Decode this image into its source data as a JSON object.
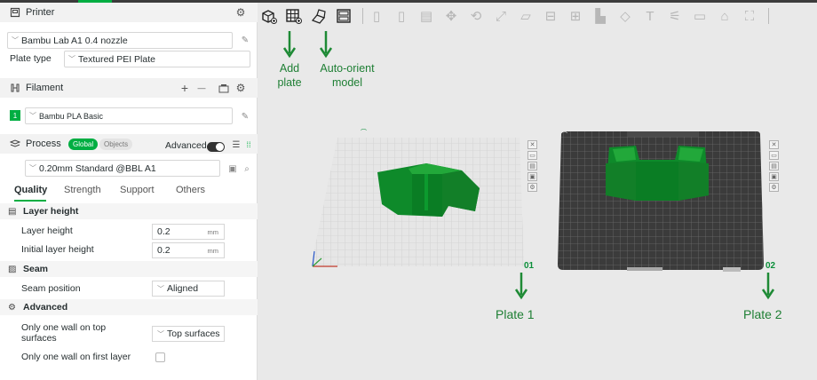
{
  "printer": {
    "section_title": "Printer",
    "model": "Bambu Lab A1 0.4 nozzle",
    "plate_type_label": "Plate type",
    "plate_type": "Textured PEI Plate"
  },
  "filament": {
    "section_title": "Filament",
    "add_label": "+",
    "remove_label": "—",
    "slot_number": "1",
    "material": "Bambu PLA Basic"
  },
  "process": {
    "section_title": "Process",
    "global_label": "Global",
    "objects_label": "Objects",
    "advanced_label": "Advanced",
    "preset": "0.20mm Standard @BBL A1",
    "tabs": [
      "Quality",
      "Strength",
      "Support",
      "Others"
    ],
    "groups": {
      "layer_height": "Layer height",
      "seam": "Seam",
      "advanced": "Advanced"
    },
    "settings": {
      "layer_height_label": "Layer height",
      "layer_height_value": "0.2",
      "initial_layer_height_label": "Initial layer height",
      "initial_layer_height_value": "0.2",
      "unit": "mm",
      "seam_position_label": "Seam position",
      "seam_position_value": "Aligned",
      "one_wall_top_label_1": "Only one wall on top",
      "one_wall_top_label_2": "surfaces",
      "one_wall_top_value": "Top surfaces",
      "one_wall_first_label": "Only one wall on first layer"
    }
  },
  "annotations": {
    "add_plate_1": "Add",
    "add_plate_2": "plate",
    "auto_orient_1": "Auto-orient",
    "auto_orient_2": "model",
    "plate1": "Plate 1",
    "plate2": "Plate 2"
  },
  "plates": {
    "plate1_number": "01",
    "plate2_number": "02"
  },
  "colors": {
    "accent": "#00ae42",
    "model_green": "#0f8f2a",
    "annotation_green": "#1e7f34"
  }
}
